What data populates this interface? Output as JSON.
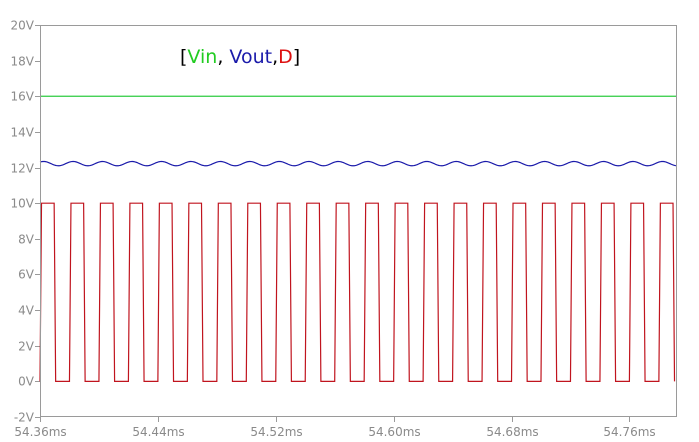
{
  "chart_data": {
    "type": "line",
    "title": "",
    "xlabel": "",
    "ylabel": "",
    "xlim": [
      54.36,
      54.7923
    ],
    "ylim": [
      -2,
      20
    ],
    "x_ticks": [
      "54.36ms",
      "54.44ms",
      "54.52ms",
      "54.60ms",
      "54.68ms",
      "54.76ms"
    ],
    "y_ticks": [
      "-2V",
      "0V",
      "2V",
      "4V",
      "6V",
      "8V",
      "10V",
      "12V",
      "14V",
      "16V",
      "18V",
      "20V"
    ],
    "grid": false,
    "legend": {
      "open": "[",
      "close": "]",
      "separator": ",",
      "items": [
        {
          "label": "Vin",
          "color": "#22cc22"
        },
        {
          "label": "Vout",
          "color": "#1a1aaa"
        },
        {
          "label": "D",
          "color": "#dd1111"
        }
      ]
    },
    "series": [
      {
        "name": "Vin",
        "color": "#2ecc40",
        "level": 16
      },
      {
        "name": "Vout",
        "color": "#1a1aaa",
        "mean": 12.22,
        "ripple_amplitude": 0.12,
        "period_ms": 0.02
      },
      {
        "name": "D",
        "color": "#c0141e",
        "low": 0,
        "high": 10,
        "period_ms": 0.02,
        "duty_cycle": 0.48,
        "first_rise_ms": 54.36
      }
    ]
  }
}
